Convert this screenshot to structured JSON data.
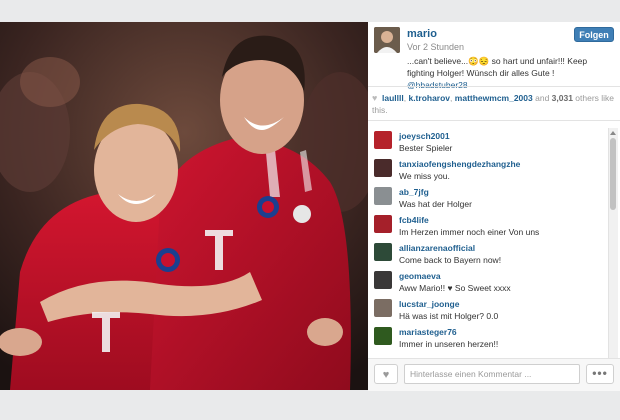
{
  "post": {
    "username": "mario",
    "time": "Vor 2 Stunden",
    "follow_label": "Folgen",
    "caption_text": "...can't believe...😳😔 so hart und unfair!!! Keep fighting Holger! Wünsch dir alles Gute ! ",
    "caption_mention": "@hbadstuber28"
  },
  "likes": {
    "icon": "heart-icon",
    "liker_1": "laullll",
    "liker_2": "k.troharov",
    "liker_3": "matthewmcm_2003",
    "sep": ", ",
    "and_text": " and ",
    "count": "3,031",
    "others_text": " others like this."
  },
  "comments": [
    {
      "user": "joeysch2001",
      "text": "Bester Spieler",
      "avatar_color": "#b5222b"
    },
    {
      "user": "tanxiaofengshengdezhangzhe",
      "text": "We miss you.",
      "avatar_color": "#4a2b2b"
    },
    {
      "user": "ab_7jfg",
      "text": "Was hat der Holger",
      "avatar_color": "#8a8f92"
    },
    {
      "user": "fcb4life",
      "text": "Im Herzen immer noch einer Von uns",
      "avatar_color": "#a5202a"
    },
    {
      "user": "allianzarenaofficial",
      "text": "Come back to Bayern now!",
      "avatar_color": "#2d4a38"
    },
    {
      "user": "geomaeva",
      "text": "Aww Mario!! ♥ So Sweet xxxx",
      "avatar_color": "#3a3838"
    },
    {
      "user": "lucstar_joonge",
      "text": "Hä was ist mit Holger? 0.0",
      "avatar_color": "#7b6d63"
    },
    {
      "user": "mariasteger76",
      "text": "Immer in unseren herzen!!",
      "avatar_color": "#2f5a1f"
    }
  ],
  "footer": {
    "comment_placeholder": "Hinterlasse einen Kommentar ...",
    "like_icon": "heart-icon",
    "more_label": "•••"
  },
  "colors": {
    "link": "#1f5f8f",
    "follow_button": "#3f7fb6",
    "jersey_red": "#c8102e"
  }
}
